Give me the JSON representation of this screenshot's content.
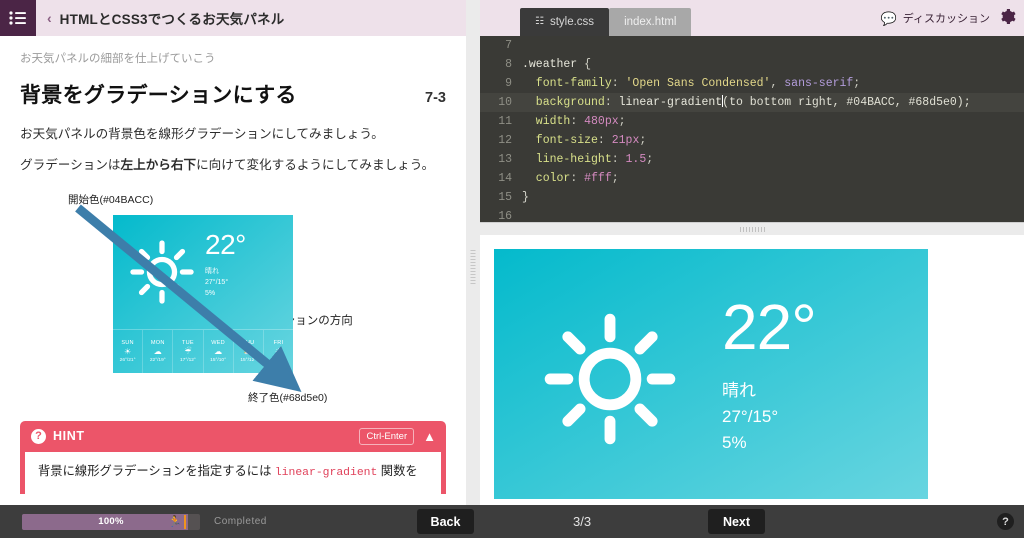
{
  "header": {
    "menu_icon": "hamburger-icon",
    "back_chevron": "‹",
    "course_title": "HTMLとCSS3でつくるお天気パネル",
    "discussion_label": "ディスカッション",
    "discussion_icon": "speech-bubble-icon",
    "settings_icon": "gear-icon"
  },
  "lesson": {
    "subtitle": "お天気パネルの細部を仕上げていこう",
    "title": "背景をグラデーションにする",
    "number": "7-3",
    "paragraph1": "お天気パネルの背景色を線形グラデーションにしてみましょう。",
    "paragraph2_pre": "グラデーションは",
    "paragraph2_bold": "左上から右下",
    "paragraph2_post": "に向けて変化するようにしてみましょう。"
  },
  "illustration": {
    "start_label": "開始色(#04BACC)",
    "end_label": "終了色(#68d5e0)",
    "direction_label": "グラデーションの方向",
    "arrow_color": "#3d7eaa",
    "gradient_start": "#04BACC",
    "gradient_end": "#68d5e0",
    "card": {
      "temp": "22°",
      "condition": "晴れ",
      "high_low": "27°/15°",
      "precipitation": "5%",
      "sun_icon": "sun-icon",
      "forecast": [
        {
          "day": "SUN",
          "icon": "sun-icon",
          "glyph": "☀",
          "temp": "26°/21°"
        },
        {
          "day": "MON",
          "icon": "cloud-icon",
          "glyph": "☁",
          "temp": "22°/19°"
        },
        {
          "day": "TUE",
          "icon": "rain-icon",
          "glyph": "☔",
          "temp": "17°/12°"
        },
        {
          "day": "WED",
          "icon": "cloud-icon",
          "glyph": "☁",
          "temp": "15°/10°"
        },
        {
          "day": "THU",
          "icon": "partly-cloudy-icon",
          "glyph": "⛅",
          "temp": "15°/12°"
        },
        {
          "day": "FRI",
          "icon": "sun-icon",
          "glyph": "☀",
          "temp": "20°"
        }
      ]
    }
  },
  "hint": {
    "icon": "question-mark-icon",
    "label": "HINT",
    "shortcut": "Ctrl-Enter",
    "collapse_icon": "chevron-up-icon",
    "body_pre": "背景に線形グラデーションを指定するには ",
    "body_code": "linear-gradient",
    "body_post": " 関数を"
  },
  "editor": {
    "tabs": [
      {
        "label": "style.css",
        "active": true,
        "icon": "file-icon"
      },
      {
        "label": "index.html",
        "active": false,
        "icon": ""
      }
    ],
    "lines": [
      {
        "num": "7",
        "highlight": false
      },
      {
        "num": "8",
        "highlight": false
      },
      {
        "num": "9",
        "highlight": false
      },
      {
        "num": "10",
        "highlight": true
      },
      {
        "num": "11",
        "highlight": false
      },
      {
        "num": "12",
        "highlight": false
      },
      {
        "num": "13",
        "highlight": false
      },
      {
        "num": "14",
        "highlight": false
      },
      {
        "num": "15",
        "highlight": false
      },
      {
        "num": "16",
        "highlight": false
      }
    ],
    "code": {
      "l7": "",
      "l8_sel": ".weather",
      "l8_brace": " {",
      "l9_prop": "  font-family",
      "l9_colon": ": ",
      "l9_str": "'Open Sans Condensed'",
      "l9_comma": ", ",
      "l9_kw": "sans-serif",
      "l9_semi": ";",
      "l10_prop": "  background",
      "l10_colon": ": ",
      "l10_fn": "linear-gradient",
      "l10_rest": "(to bottom right, #04BACC, #68d5e0);",
      "l11_prop": "  width",
      "l11_colon": ": ",
      "l11_val": "480px",
      "l11_semi": ";",
      "l12_prop": "  font-size",
      "l12_colon": ": ",
      "l12_val": "21px",
      "l12_semi": ";",
      "l13_prop": "  line-height",
      "l13_colon": ": ",
      "l13_val": "1.5",
      "l13_semi": ";",
      "l14_prop": "  color",
      "l14_colon": ": ",
      "l14_val": "#fff",
      "l14_semi": ";",
      "l15_brace": "}",
      "l16": ""
    }
  },
  "preview": {
    "gradient_start": "#04BACC",
    "gradient_end": "#68d5e0",
    "sun_icon": "sun-icon",
    "temp": "22°",
    "condition": "晴れ",
    "high_low": "27°/15°",
    "precipitation": "5%"
  },
  "bottom_bar": {
    "progress_percent": "100%",
    "progress_value": 100,
    "runner_icon": "runner-icon",
    "status": "Completed",
    "back_label": "Back",
    "page_indicator": "3/3",
    "next_label": "Next",
    "help_label": "?",
    "accent_color": "#8c6a8c"
  }
}
